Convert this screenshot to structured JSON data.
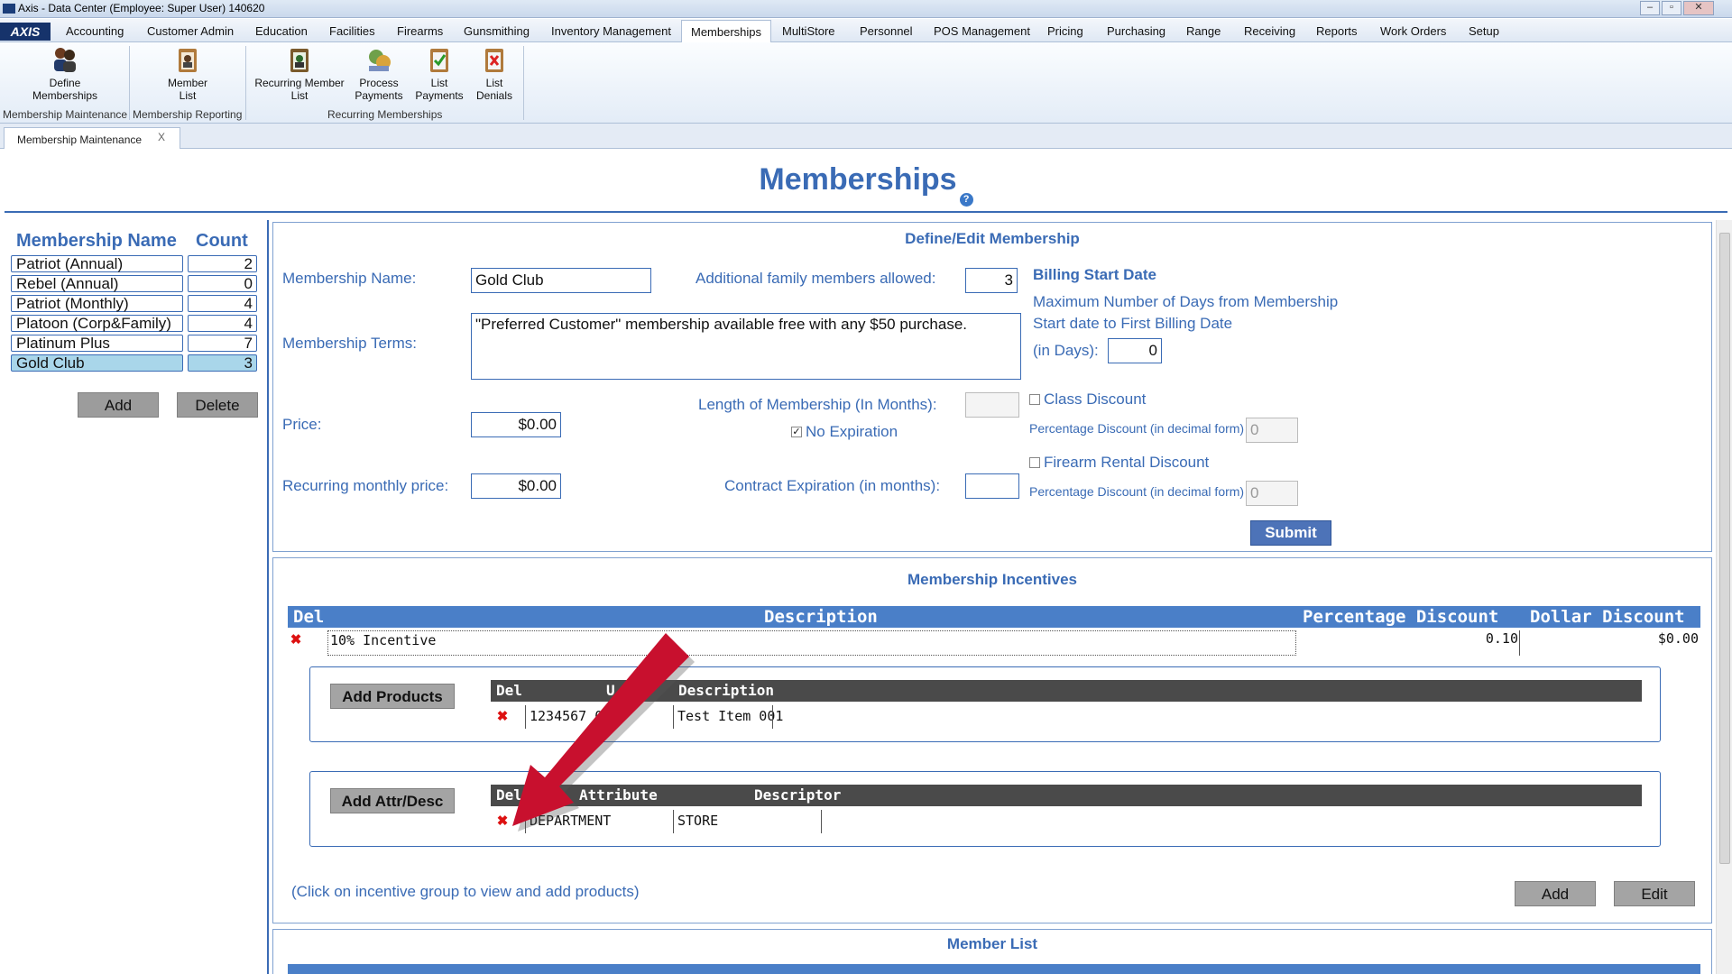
{
  "window": {
    "title": "Axis - Data Center  (Employee: Super User) 140620"
  },
  "menu": {
    "logo": "AXIS",
    "items": [
      "Accounting",
      "Customer Admin",
      "Education",
      "Facilities",
      "Firearms",
      "Gunsmithing",
      "Inventory Management",
      "Memberships",
      "MultiStore",
      "Personnel",
      "POS Management",
      "Pricing",
      "Purchasing",
      "Range",
      "Receiving",
      "Reports",
      "Work Orders",
      "Setup"
    ],
    "active": "Memberships"
  },
  "ribbon": {
    "buttons": [
      {
        "label1": "Define",
        "label2": "Memberships"
      },
      {
        "label1": "Member",
        "label2": "List"
      },
      {
        "label1": "Recurring Member",
        "label2": "List"
      },
      {
        "label1": "Process",
        "label2": "Payments"
      },
      {
        "label1": "List",
        "label2": "Payments"
      },
      {
        "label1": "List",
        "label2": "Denials"
      }
    ],
    "groups": [
      "Membership Maintenance",
      "Membership Reporting",
      "Recurring Memberships"
    ]
  },
  "doc_tab": {
    "label": "Membership Maintenance",
    "close": "X"
  },
  "page": {
    "title": "Memberships",
    "help": "?"
  },
  "membership_list": {
    "header_name": "Membership Name",
    "header_count": "Count",
    "rows": [
      {
        "name": "Patriot (Annual)",
        "count": "2"
      },
      {
        "name": "Rebel (Annual)",
        "count": "0"
      },
      {
        "name": "Patriot (Monthly)",
        "count": "4"
      },
      {
        "name": "Platoon (Corp&Family)",
        "count": "4"
      },
      {
        "name": "Platinum Plus",
        "count": "7"
      },
      {
        "name": "Gold Club",
        "count": "3"
      }
    ],
    "selected_index": 5,
    "add_label": "Add",
    "delete_label": "Delete"
  },
  "define_edit": {
    "title": "Define/Edit Membership",
    "name_label": "Membership Name:",
    "name_value": "Gold Club",
    "family_label": "Additional family members allowed:",
    "family_value": "3",
    "terms_label": "Membership Terms:",
    "terms_value": "\"Preferred Customer\" membership available free with any $50 purchase.",
    "price_label": "Price:",
    "price_value": "$0.00",
    "recurring_label": "Recurring monthly price:",
    "recurring_value": "$0.00",
    "length_label": "Length of Membership (In Months):",
    "length_value": "",
    "no_expiration_label": "No Expiration",
    "no_expiration_checked": true,
    "contract_label": "Contract Expiration (in months):",
    "contract_value": "",
    "billing_title": "Billing Start Date",
    "billing_desc1": "Maximum Number of Days from Membership",
    "billing_desc2": "Start date to First Billing Date",
    "billing_days_label": "(in Days):",
    "billing_days_value": "0",
    "class_discount_label": "Class Discount",
    "class_discount_checked": false,
    "pct_label": "Percentage Discount (in decimal form)",
    "class_pct_value": "0",
    "firearm_discount_label": "Firearm Rental Discount",
    "firearm_discount_checked": false,
    "firearm_pct_value": "0",
    "submit_label": "Submit"
  },
  "incentives": {
    "title": "Membership Incentives",
    "headers": {
      "del": "Del",
      "description": "Description",
      "pct": "Percentage Discount",
      "dollar": "Dollar Discount"
    },
    "rows": [
      {
        "description": "10% Incentive",
        "pct": "0.10",
        "dollar": "$0.00"
      }
    ],
    "add_products_label": "Add Products",
    "products_headers": {
      "del": "Del",
      "upc": "U",
      "description": "Description"
    },
    "products_rows": [
      {
        "upc": "1234567 01",
        "description": "Test Item 001"
      }
    ],
    "add_attr_label": "Add Attr/Desc",
    "attr_headers": {
      "del": "Del",
      "attribute": "Attribute",
      "descriptor": "Descriptor"
    },
    "attr_rows": [
      {
        "attribute": "DEPARTMENT",
        "descriptor": "STORE"
      }
    ],
    "hint": "(Click on incentive group to view and add products)",
    "add_label": "Add",
    "edit_label": "Edit"
  },
  "member_list": {
    "title": "Member List"
  },
  "colors": {
    "accent": "#3a6bb5",
    "header_blue": "#4a7fc8",
    "selected": "#a9d6ea",
    "arrow": "#c8102e"
  }
}
